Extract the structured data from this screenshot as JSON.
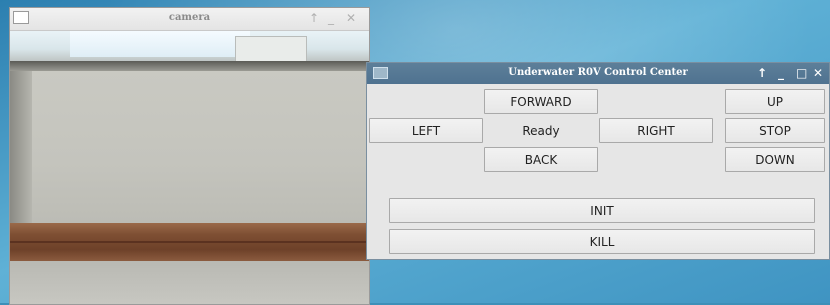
{
  "camera_window": {
    "title": "camera",
    "controls": {
      "pin": "↑",
      "minimize": "_",
      "close": "✕"
    }
  },
  "control_window": {
    "title": "Underwater R0V Control Center",
    "controls": {
      "pin": "↑",
      "minimize": "_",
      "maximize": "□",
      "close": "✕"
    },
    "buttons": {
      "forward": "FORWARD",
      "left": "LEFT",
      "right": "RIGHT",
      "back": "BACK",
      "up": "UP",
      "stop": "STOP",
      "down": "DOWN",
      "init": "INIT",
      "kill": "KILL"
    },
    "status": "Ready"
  }
}
